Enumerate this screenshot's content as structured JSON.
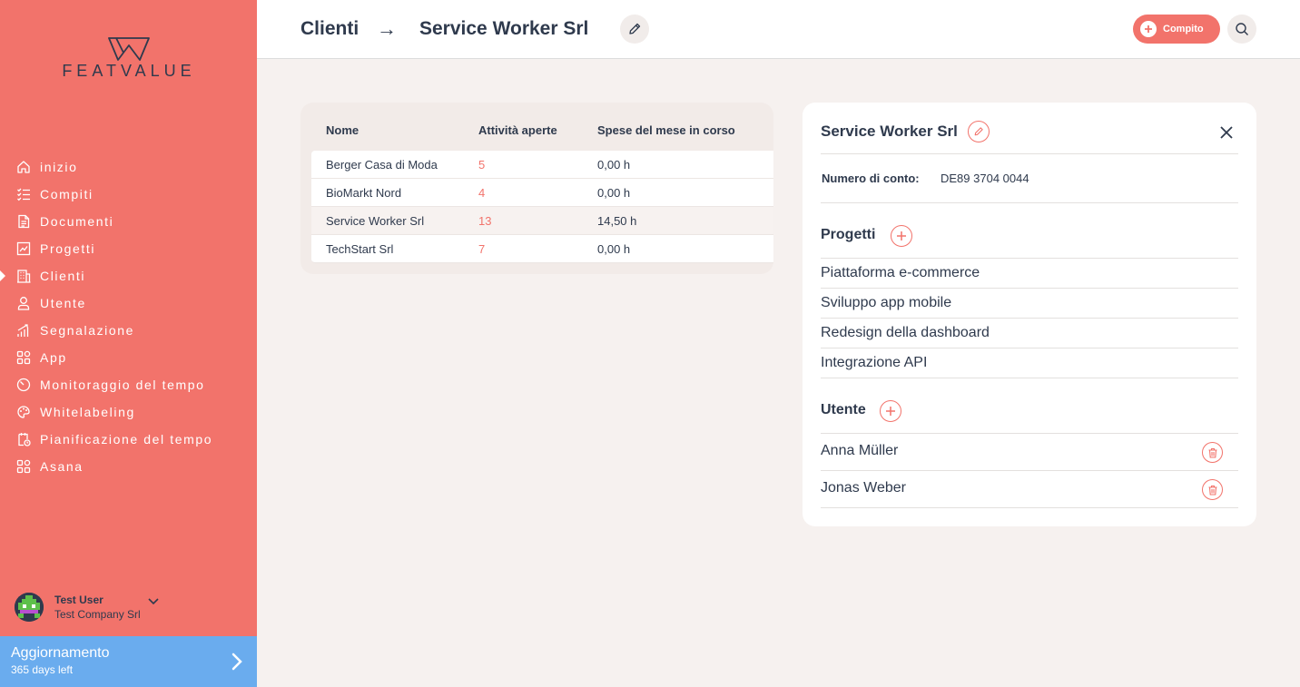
{
  "brand": {
    "logo_text": "FEATVALUE"
  },
  "sidebar": {
    "items": [
      {
        "label": "inizio",
        "icon": "home-icon"
      },
      {
        "label": "Compiti",
        "icon": "tasks-icon"
      },
      {
        "label": "Documenti",
        "icon": "documents-icon"
      },
      {
        "label": "Progetti",
        "icon": "projects-icon"
      },
      {
        "label": "Clienti",
        "icon": "clients-icon",
        "active": true
      },
      {
        "label": "Utente",
        "icon": "user-icon"
      },
      {
        "label": "Segnalazione",
        "icon": "reporting-icon"
      },
      {
        "label": "App",
        "icon": "apps-icon"
      },
      {
        "label": "Monitoraggio del tempo",
        "icon": "timer-icon"
      },
      {
        "label": "Whitelabeling",
        "icon": "whitelabel-icon"
      },
      {
        "label": "Pianificazione del tempo",
        "icon": "schedule-icon"
      },
      {
        "label": "Asana",
        "icon": "asana-icon"
      }
    ],
    "user": {
      "name": "Test User",
      "company": "Test Company Srl"
    },
    "upgrade": {
      "title": "Aggiornamento",
      "subtitle": "365 days left"
    }
  },
  "header": {
    "breadcrumb_root": "Clienti",
    "breadcrumb_arrow": "→",
    "breadcrumb_current": "Service Worker Srl",
    "task_button_label": "Compito"
  },
  "table": {
    "headers": [
      "Nome",
      "Attività aperte",
      "Spese del mese in corso"
    ],
    "rows": [
      [
        "Berger Casa di Moda",
        "5",
        "0,00 h"
      ],
      [
        "BioMarkt Nord",
        "4",
        "0,00 h"
      ],
      [
        "Service Worker Srl",
        "13",
        "14,50 h"
      ],
      [
        "TechStart Srl",
        "7",
        "0,00 h"
      ]
    ]
  },
  "detail": {
    "title": "Service Worker Srl",
    "account_label": "Numero di conto:",
    "account_value": "DE89 3704 0044",
    "projects_title": "Progetti",
    "projects": [
      "Piattaforma e-commerce",
      "Sviluppo app mobile",
      "Redesign della dashboard",
      "Integrazione API"
    ],
    "users_title": "Utente",
    "users": [
      "Anna Müller",
      "Jonas Weber"
    ]
  },
  "colors": {
    "accent": "#f2736b",
    "sidebar_bg": "#f2736b",
    "upgrade_bg": "#6aacee",
    "text": "#2f3a4d"
  }
}
